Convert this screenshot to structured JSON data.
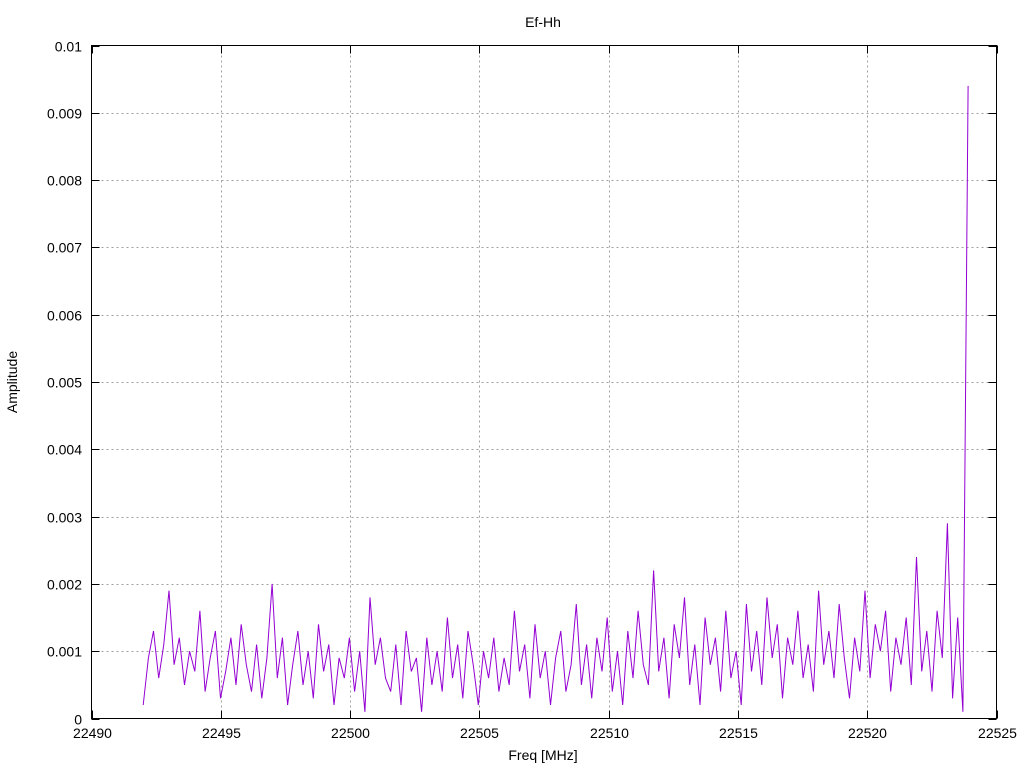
{
  "chart_data": {
    "type": "line",
    "title": "Ef-Hh",
    "xlabel": "Freq [MHz]",
    "ylabel": "Amplitude",
    "xlim": [
      22490,
      22525
    ],
    "ylim": [
      0,
      0.01
    ],
    "grid": true,
    "x_ticks": [
      "22490",
      "22495",
      "22500",
      "22505",
      "22510",
      "22515",
      "22520",
      "22525"
    ],
    "y_ticks": [
      "0",
      "0.001",
      "0.002",
      "0.003",
      "0.004",
      "0.005",
      "0.006",
      "0.007",
      "0.008",
      "0.009",
      "0.01"
    ],
    "series": [
      {
        "name": "Ef-Hh",
        "color": "#9400d3",
        "x_start": 22492.0,
        "x_end": 22523.9,
        "values": [
          0.0002,
          0.0009,
          0.0013,
          0.0006,
          0.0011,
          0.0019,
          0.0008,
          0.0012,
          0.0005,
          0.001,
          0.0007,
          0.0016,
          0.0004,
          0.0009,
          0.0013,
          0.0003,
          0.0007,
          0.0012,
          0.0005,
          0.0014,
          0.0008,
          0.0004,
          0.0011,
          0.0003,
          0.0009,
          0.002,
          0.0006,
          0.0012,
          0.0002,
          0.0008,
          0.0013,
          0.0005,
          0.001,
          0.0003,
          0.0014,
          0.0007,
          0.0011,
          0.0002,
          0.0009,
          0.0006,
          0.0012,
          0.0004,
          0.001,
          0.0001,
          0.0018,
          0.0008,
          0.0012,
          0.0006,
          0.0004,
          0.0011,
          0.0002,
          0.0013,
          0.0007,
          0.0009,
          0.0001,
          0.0012,
          0.0005,
          0.001,
          0.0004,
          0.0015,
          0.0006,
          0.0011,
          0.0003,
          0.0013,
          0.0008,
          0.0002,
          0.001,
          0.0006,
          0.0012,
          0.0004,
          0.0009,
          0.0005,
          0.0016,
          0.0007,
          0.0011,
          0.0003,
          0.0014,
          0.0006,
          0.001,
          0.0002,
          0.0009,
          0.0013,
          0.0004,
          0.0008,
          0.0017,
          0.0005,
          0.0011,
          0.0003,
          0.0012,
          0.0007,
          0.0015,
          0.0004,
          0.001,
          0.0002,
          0.0013,
          0.0006,
          0.0016,
          0.0008,
          0.0005,
          0.0022,
          0.0007,
          0.0012,
          0.0003,
          0.0014,
          0.0009,
          0.0018,
          0.0005,
          0.0011,
          0.0002,
          0.0015,
          0.0008,
          0.0012,
          0.0004,
          0.0016,
          0.0006,
          0.001,
          0.0002,
          0.0017,
          0.0007,
          0.0013,
          0.0005,
          0.0018,
          0.0009,
          0.0014,
          0.0003,
          0.0012,
          0.0008,
          0.0016,
          0.0006,
          0.0011,
          0.0004,
          0.0019,
          0.0008,
          0.0013,
          0.0006,
          0.0017,
          0.0009,
          0.0003,
          0.0012,
          0.0007,
          0.0019,
          0.0006,
          0.0014,
          0.001,
          0.0016,
          0.0004,
          0.0012,
          0.0008,
          0.0015,
          0.0005,
          0.0024,
          0.0007,
          0.0013,
          0.0004,
          0.0016,
          0.0009,
          0.0029,
          0.0003,
          0.0015,
          0.0001,
          0.0094
        ]
      }
    ]
  }
}
